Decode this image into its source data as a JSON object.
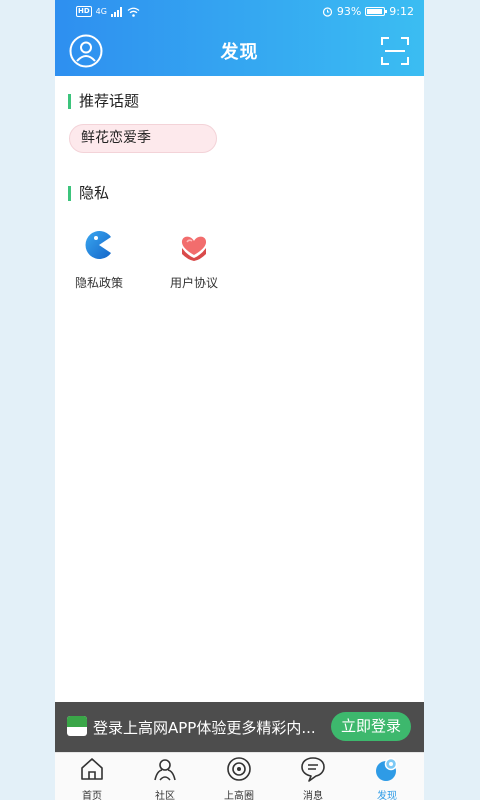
{
  "status_bar": {
    "network_badge": "HD",
    "signal_label": "4G",
    "battery_percent": "93%",
    "battery_level": 0.93,
    "time": "9:12"
  },
  "header": {
    "title": "发现",
    "left_icon": "user-avatar-icon",
    "right_icon": "scan-icon"
  },
  "recommended": {
    "heading": "推荐话题",
    "topics": [
      "鲜花恋爱季"
    ]
  },
  "privacy": {
    "heading": "隐私",
    "items": [
      {
        "label": "隐私政策",
        "icon": "privacy-pacman-icon"
      },
      {
        "label": "用户协议",
        "icon": "heart-hands-icon"
      }
    ]
  },
  "login_banner": {
    "text": "登录上高网APP体验更多精彩内...",
    "button_label": "立即登录"
  },
  "tabbar": {
    "tabs": [
      {
        "label": "首页",
        "icon": "home-icon",
        "active": false
      },
      {
        "label": "社区",
        "icon": "community-icon",
        "active": false
      },
      {
        "label": "上高圈",
        "icon": "circle-icon",
        "active": false
      },
      {
        "label": "消息",
        "icon": "message-icon",
        "active": false
      },
      {
        "label": "发现",
        "icon": "discover-icon",
        "active": true
      }
    ]
  },
  "colors": {
    "header_start": "#2e8ff0",
    "header_end": "#3bbdf2",
    "accent_green": "#3cc47c",
    "active_tab": "#2e9be6",
    "chip_bg": "#fde9ec"
  }
}
